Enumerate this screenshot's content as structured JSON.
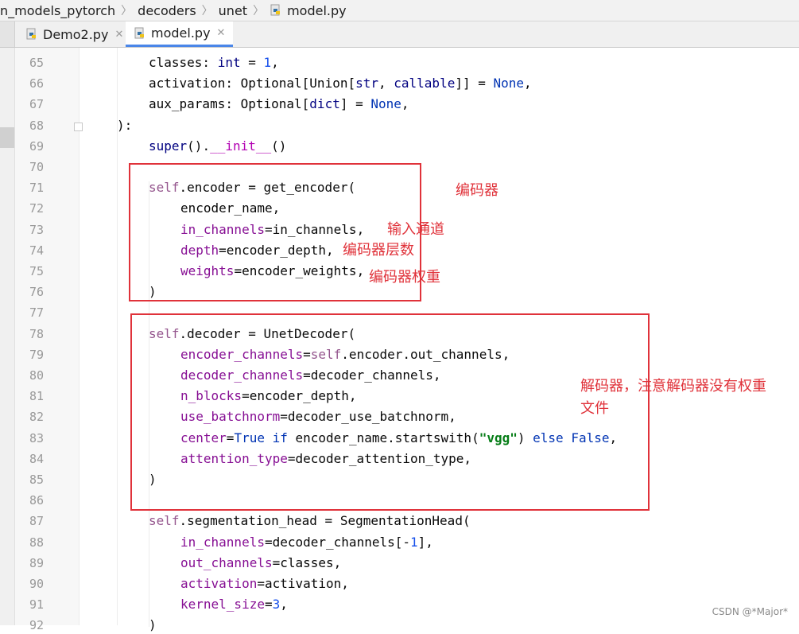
{
  "breadcrumb": {
    "items": [
      "n_models_pytorch",
      "decoders",
      "unet",
      "model.py"
    ]
  },
  "tabs": [
    {
      "label": "Demo2.py",
      "active": false
    },
    {
      "label": "model.py",
      "active": true
    }
  ],
  "editor": {
    "first_line_number": 65,
    "lines": [
      {
        "n": "65",
        "indent": 2,
        "tokens": [
          [
            "plain",
            "classes: "
          ],
          [
            "builtin",
            "int"
          ],
          [
            "plain",
            " = "
          ],
          [
            "num",
            "1"
          ],
          [
            "plain",
            ","
          ]
        ]
      },
      {
        "n": "66",
        "indent": 2,
        "tokens": [
          [
            "plain",
            "activation: Optional["
          ],
          [
            "plain",
            "Union["
          ],
          [
            "builtin",
            "str"
          ],
          [
            "plain",
            ", "
          ],
          [
            "builtin",
            "callable"
          ],
          [
            "plain",
            "]] = "
          ],
          [
            "kw",
            "None"
          ],
          [
            "plain",
            ","
          ]
        ]
      },
      {
        "n": "67",
        "indent": 2,
        "tokens": [
          [
            "plain",
            "aux_params: Optional["
          ],
          [
            "builtin",
            "dict"
          ],
          [
            "plain",
            "] = "
          ],
          [
            "kw",
            "None"
          ],
          [
            "plain",
            ","
          ]
        ]
      },
      {
        "n": "68",
        "indent": 1,
        "tokens": [
          [
            "plain",
            "):"
          ]
        ]
      },
      {
        "n": "69",
        "indent": 2,
        "tokens": [
          [
            "builtin",
            "super"
          ],
          [
            "plain",
            "()."
          ],
          [
            "magic",
            "__init__"
          ],
          [
            "plain",
            "()"
          ]
        ]
      },
      {
        "n": "70",
        "indent": 2,
        "tokens": []
      },
      {
        "n": "71",
        "indent": 2,
        "tokens": [
          [
            "self",
            "self"
          ],
          [
            "plain",
            ".encoder = get_encoder("
          ]
        ]
      },
      {
        "n": "72",
        "indent": 3,
        "tokens": [
          [
            "plain",
            "encoder_name,"
          ]
        ]
      },
      {
        "n": "73",
        "indent": 3,
        "tokens": [
          [
            "param",
            "in_channels"
          ],
          [
            "plain",
            "=in_channels,"
          ]
        ]
      },
      {
        "n": "74",
        "indent": 3,
        "tokens": [
          [
            "param",
            "depth"
          ],
          [
            "plain",
            "=encoder_depth,"
          ]
        ]
      },
      {
        "n": "75",
        "indent": 3,
        "tokens": [
          [
            "param",
            "weights"
          ],
          [
            "plain",
            "=encoder_weights,"
          ]
        ]
      },
      {
        "n": "76",
        "indent": 2,
        "tokens": [
          [
            "plain",
            ")"
          ]
        ]
      },
      {
        "n": "77",
        "indent": 2,
        "tokens": []
      },
      {
        "n": "78",
        "indent": 2,
        "tokens": [
          [
            "self",
            "self"
          ],
          [
            "plain",
            ".decoder = UnetDecoder("
          ]
        ]
      },
      {
        "n": "79",
        "indent": 3,
        "tokens": [
          [
            "param",
            "encoder_channels"
          ],
          [
            "plain",
            "="
          ],
          [
            "self",
            "self"
          ],
          [
            "plain",
            ".encoder.out_channels,"
          ]
        ]
      },
      {
        "n": "80",
        "indent": 3,
        "tokens": [
          [
            "param",
            "decoder_channels"
          ],
          [
            "plain",
            "=decoder_channels,"
          ]
        ]
      },
      {
        "n": "81",
        "indent": 3,
        "tokens": [
          [
            "param",
            "n_blocks"
          ],
          [
            "plain",
            "=encoder_depth,"
          ]
        ]
      },
      {
        "n": "82",
        "indent": 3,
        "tokens": [
          [
            "param",
            "use_batchnorm"
          ],
          [
            "plain",
            "=decoder_use_batchnorm,"
          ]
        ]
      },
      {
        "n": "83",
        "indent": 3,
        "tokens": [
          [
            "param",
            "center"
          ],
          [
            "plain",
            "="
          ],
          [
            "kw",
            "True"
          ],
          [
            "plain",
            " "
          ],
          [
            "kw",
            "if"
          ],
          [
            "plain",
            " encoder_name.startswith("
          ],
          [
            "str",
            "\"vgg\""
          ],
          [
            "plain",
            ") "
          ],
          [
            "kw",
            "else"
          ],
          [
            "plain",
            " "
          ],
          [
            "kw",
            "False"
          ],
          [
            "plain",
            ","
          ]
        ]
      },
      {
        "n": "84",
        "indent": 3,
        "tokens": [
          [
            "param",
            "attention_type"
          ],
          [
            "plain",
            "=decoder_attention_type,"
          ]
        ]
      },
      {
        "n": "85",
        "indent": 2,
        "tokens": [
          [
            "plain",
            ")"
          ]
        ]
      },
      {
        "n": "86",
        "indent": 2,
        "tokens": []
      },
      {
        "n": "87",
        "indent": 2,
        "tokens": [
          [
            "self",
            "self"
          ],
          [
            "plain",
            ".segmentation_head = SegmentationHead("
          ]
        ]
      },
      {
        "n": "88",
        "indent": 3,
        "tokens": [
          [
            "param",
            "in_channels"
          ],
          [
            "plain",
            "=decoder_channels[-"
          ],
          [
            "num",
            "1"
          ],
          [
            "plain",
            "],"
          ]
        ]
      },
      {
        "n": "89",
        "indent": 3,
        "tokens": [
          [
            "param",
            "out_channels"
          ],
          [
            "plain",
            "=classes,"
          ]
        ]
      },
      {
        "n": "90",
        "indent": 3,
        "tokens": [
          [
            "param",
            "activation"
          ],
          [
            "plain",
            "=activation,"
          ]
        ]
      },
      {
        "n": "91",
        "indent": 3,
        "tokens": [
          [
            "param",
            "kernel_size"
          ],
          [
            "plain",
            "="
          ],
          [
            "num",
            "3"
          ],
          [
            "plain",
            ","
          ]
        ]
      },
      {
        "n": "92",
        "indent": 2,
        "tokens": [
          [
            "plain",
            ")"
          ]
        ]
      }
    ]
  },
  "annotations": {
    "encoder": "编码器",
    "in_channels": "输入通道",
    "depth": "编码器层数",
    "weights": "编码器权重",
    "decoder_line1": "解码器，注意解码器没有权重",
    "decoder_line2": "文件"
  },
  "colors": {
    "annotation_red": "#e0323a",
    "keyword_blue": "#0033b3",
    "self_purple": "#94558d",
    "param_magenta": "#871094",
    "string_green": "#067d17",
    "tab_underline": "#4a86e8"
  },
  "watermark": "CSDN @*Major*"
}
